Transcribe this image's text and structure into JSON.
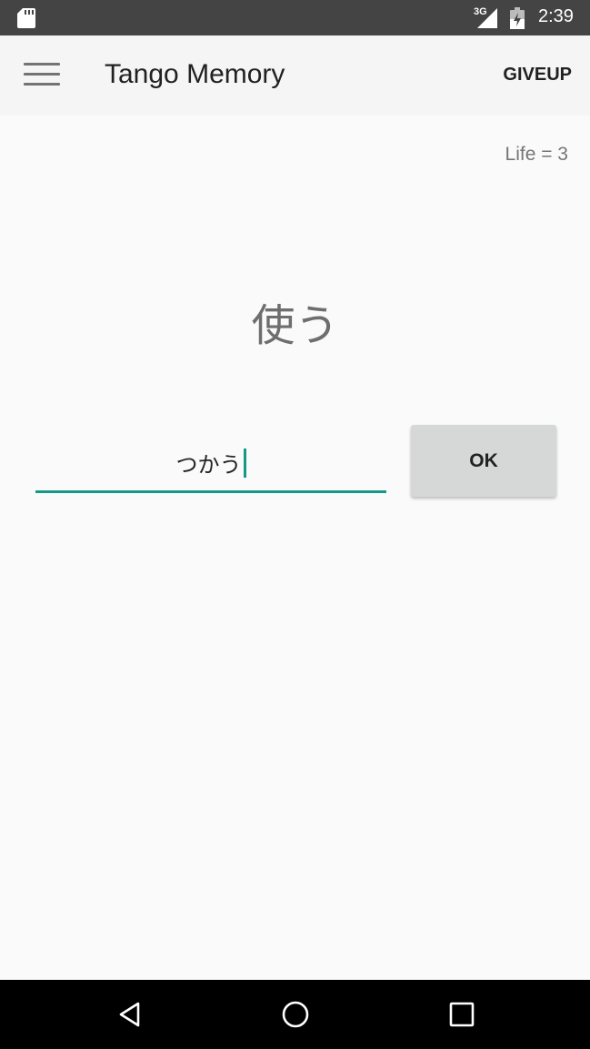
{
  "status_bar": {
    "network_label": "3G",
    "time": "2:39",
    "icons": [
      "sd-card-icon",
      "signal-icon",
      "battery-icon"
    ]
  },
  "app_bar": {
    "menu_icon": "hamburger-menu-icon",
    "title": "Tango Memory",
    "action_label": "GIVEUP"
  },
  "game": {
    "life_text": "Life = 3",
    "word": "使う",
    "answer_value": "つかう",
    "ok_label": "OK"
  },
  "nav_bar": {
    "icons": [
      "back-icon",
      "home-icon",
      "recents-icon"
    ]
  },
  "colors": {
    "status_bar": "#444444",
    "app_bar": "#f5f5f5",
    "background": "#fafafa",
    "accent": "#169886",
    "button": "#d6d7d7",
    "nav_bar": "#000000"
  }
}
